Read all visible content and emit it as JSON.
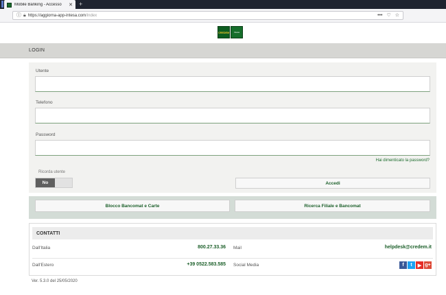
{
  "browser": {
    "tab_title": "Mobile Banking - Accesso",
    "tab_close": "✕",
    "new_tab": "+",
    "url_host": "https://aggiorna-app-intesa.com",
    "url_path": "/index",
    "url_actions": [
      "•••",
      "♡",
      "☆"
    ]
  },
  "logo": {
    "brand": "CREDEM",
    "sub": "Intesa"
  },
  "section": {
    "title": "LOGIN"
  },
  "form": {
    "user_label": "Utente",
    "user_value": "",
    "phone_label": "Telefono",
    "phone_value": "",
    "password_label": "Password",
    "password_value": "",
    "forgot_link": "Hai dimenticato la password?",
    "remember_label": "Ricorda utente",
    "remember_state": "No",
    "login_button": "Accedi"
  },
  "quick": {
    "block_button": "Blocco Bancomat e Carte",
    "search_button": "Ricerca Filiale e Bancomat"
  },
  "contacts": {
    "title": "CONTATTI",
    "italy_label": "Dall'Italia",
    "italy_number": "800.27.33.36",
    "mail_label": "Mail",
    "mail_value": "helpdesk@credem.it",
    "abroad_label": "Dall'Estero",
    "abroad_number": "+39 0522.583.585",
    "social_label": "Social Media",
    "socials": [
      {
        "icon": "facebook-icon",
        "glyph": "f",
        "color": "#3b5998"
      },
      {
        "icon": "twitter-icon",
        "glyph": "t",
        "color": "#1da1f2"
      },
      {
        "icon": "youtube-icon",
        "glyph": "▶",
        "color": "#e52d27"
      },
      {
        "icon": "googleplus-icon",
        "glyph": "g+",
        "color": "#dd4b39"
      }
    ]
  },
  "footer": {
    "version": "Ver. 5.3.0 del 25/05/2020"
  },
  "colors": {
    "accent_green": "#1a5e28",
    "section_gray": "#d6d6d3",
    "quick_panel": "#d3dcd6"
  }
}
